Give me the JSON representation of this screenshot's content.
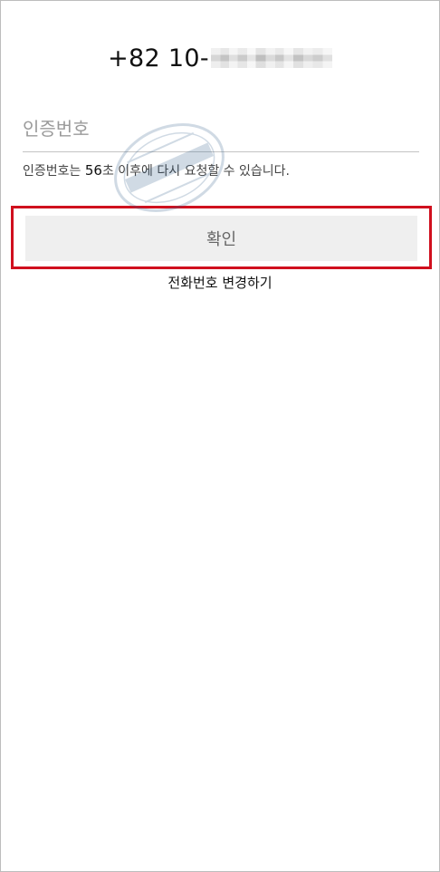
{
  "phone": {
    "prefix": "+82 10-",
    "masked": true
  },
  "verification": {
    "placeholder": "인증번호",
    "value": ""
  },
  "timer": {
    "before": "인증번호는 ",
    "seconds": "56",
    "after": "초 이후에 다시 요청할 수 있습니다."
  },
  "buttons": {
    "confirm_label": "확인",
    "change_phone_label": "전화번호 변경하기"
  },
  "colors": {
    "highlight_border": "#d0101e",
    "button_background": "#efefef",
    "button_text": "#666666",
    "placeholder_text": "#9a9a9a"
  }
}
